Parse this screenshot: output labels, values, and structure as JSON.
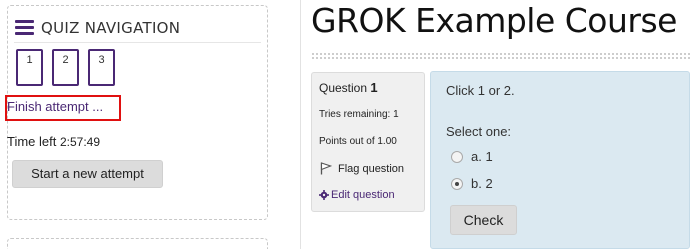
{
  "quiz_navigation": {
    "title": "QUIZ NAVIGATION",
    "question_buttons": [
      "1",
      "2",
      "3"
    ],
    "finish_attempt": "Finish attempt ...",
    "time_left_label": "Time left",
    "time_left_value": "2:57:49",
    "start_new_attempt": "Start a new attempt"
  },
  "course": {
    "title": "GROK Example Course"
  },
  "question_info": {
    "question_label": "Question",
    "question_number": "1",
    "tries_remaining": "Tries remaining: 1",
    "points": "Points out of 1.00",
    "flag_question": "Flag question",
    "edit_question": "Edit question"
  },
  "question": {
    "text": "Click 1 or 2.",
    "select_one": "Select one:",
    "options": [
      {
        "label": "a. 1",
        "checked": false
      },
      {
        "label": "b. 2",
        "checked": true
      }
    ],
    "check_button": "Check"
  },
  "colors": {
    "accent": "#4a2874",
    "highlight_border": "#e01010",
    "question_bg": "#dbe9f1"
  }
}
